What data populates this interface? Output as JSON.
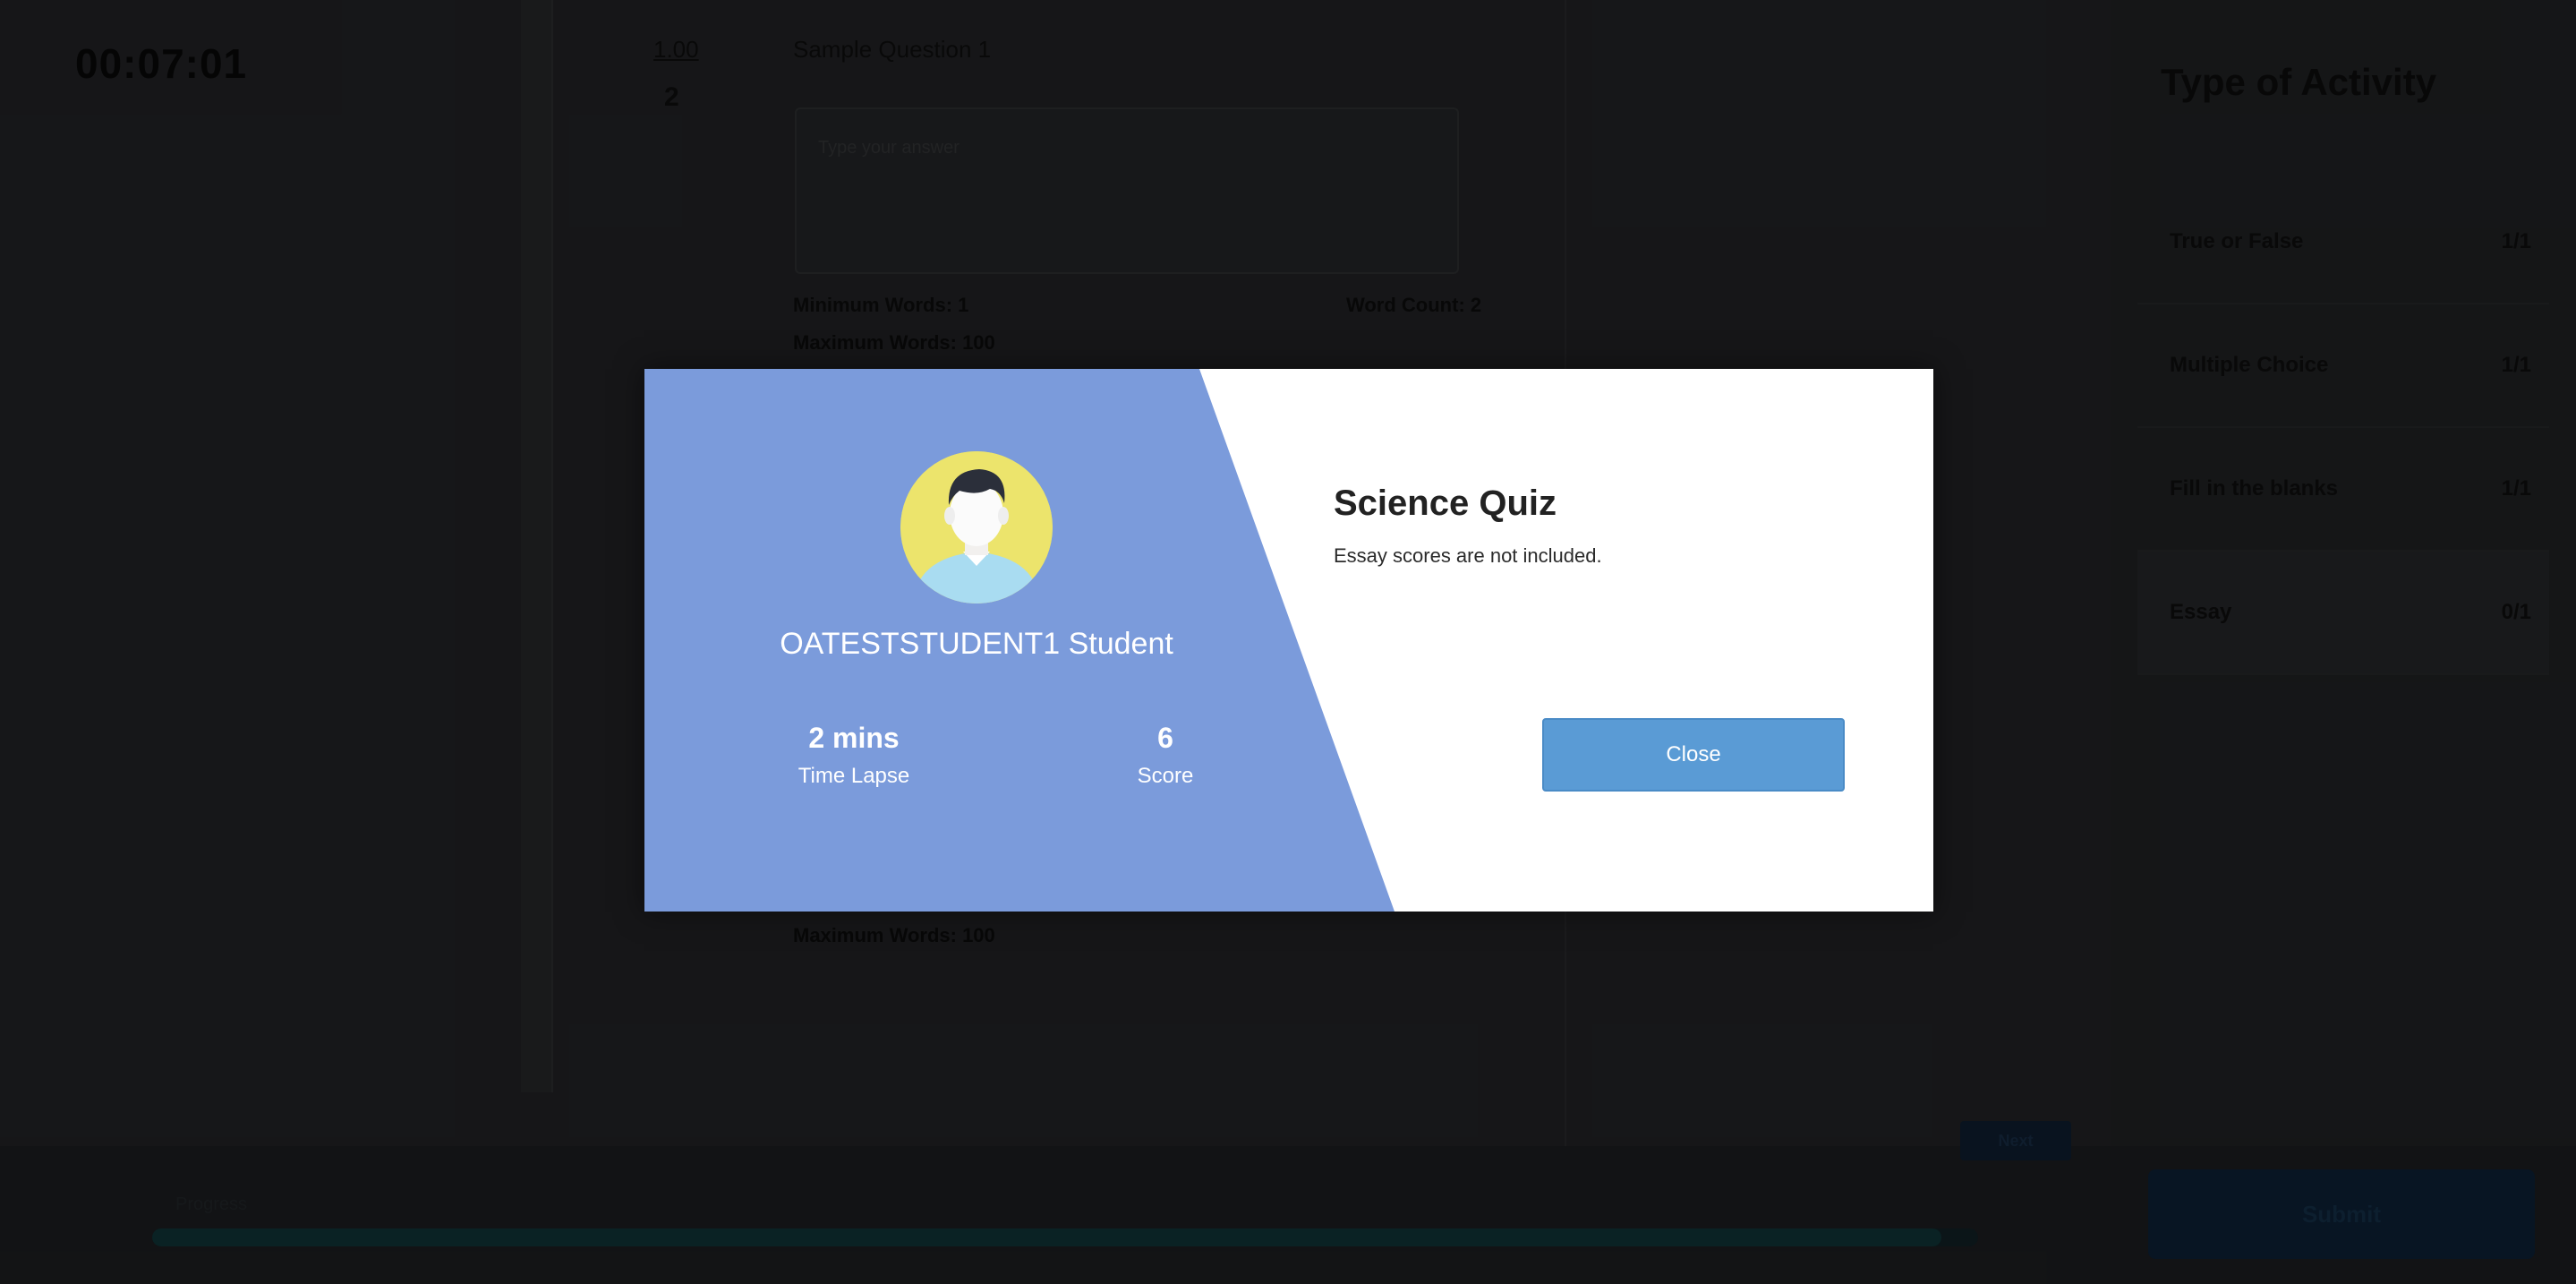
{
  "background": {
    "timer": "00:07:01",
    "question_number": "1.00",
    "question_points": "2",
    "question_title": "Sample Question 1",
    "answer_placeholder": "Type your answer",
    "minimum_words": "Minimum Words: 1",
    "word_count": "Word Count: 2",
    "maximum_words": "Maximum Words: 100",
    "maximum_words_2": "Maximum Words: 100",
    "activity_panel": {
      "title": "Type of Activity",
      "items": [
        {
          "name": "True or False",
          "count": "1/1"
        },
        {
          "name": "Multiple Choice",
          "count": "1/1"
        },
        {
          "name": "Fill in the blanks",
          "count": "1/1"
        },
        {
          "name": "Essay",
          "count": "0/1"
        }
      ]
    },
    "progress_label": "Progress",
    "progress_fraction": 0.98,
    "small_button_label": "Next",
    "submit_label": "Submit"
  },
  "modal": {
    "student_name": "OATESTSTUDENT1 Student",
    "time_value": "2 mins",
    "time_label": "Time Lapse",
    "score_value": "6",
    "score_label": "Score",
    "quiz_title": "Science Quiz",
    "quiz_note": "Essay scores are not included.",
    "close_label": "Close"
  },
  "colors": {
    "modal_accent": "#7b9bdb",
    "close_button": "#5a9bd5",
    "avatar_bg": "#ece46c",
    "shirt": "#a9dcf1",
    "hair": "#2b2f3a"
  }
}
